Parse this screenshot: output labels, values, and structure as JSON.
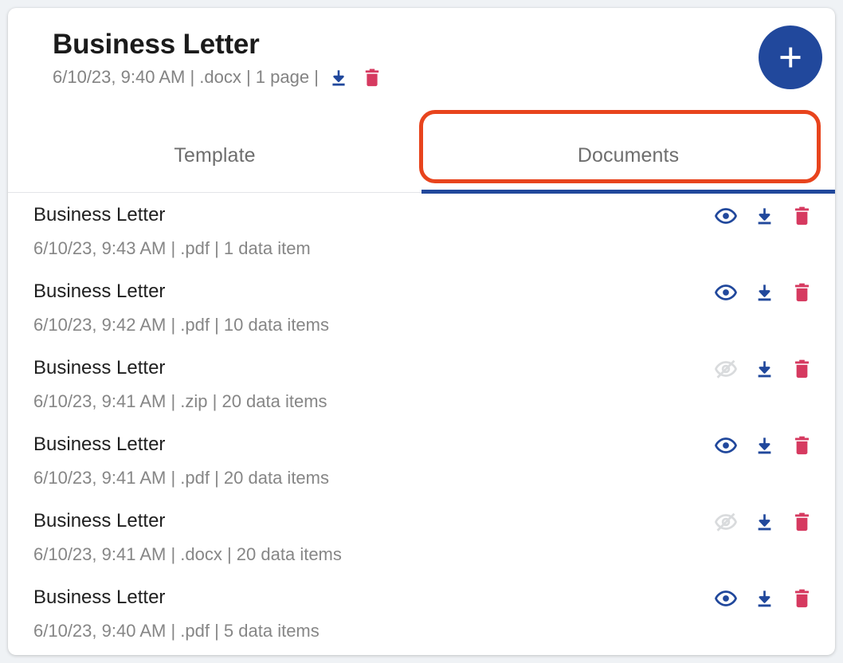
{
  "colors": {
    "page_background": "#eff2f5",
    "card_background": "#ffffff",
    "accent_blue": "#21489c",
    "danger_red": "#d63a60",
    "annotation_orange": "#e8441d",
    "muted_text": "#868686",
    "title_text": "#1f1f1f"
  },
  "header": {
    "title": "Business Letter",
    "meta": "6/10/23, 9:40 AM | .docx | 1 page |",
    "download_icon": "download-icon",
    "delete_icon": "trash-icon",
    "add_button": {
      "icon": "plus-icon",
      "label": "+"
    }
  },
  "tabs": {
    "items": [
      {
        "label": "Template",
        "active": false
      },
      {
        "label": "Documents",
        "active": true
      }
    ],
    "active_index": 1,
    "annotation": "highlight-rectangle-around-documents-tab"
  },
  "documents": [
    {
      "title": "Business Letter",
      "meta": "6/10/23, 9:43 AM | .pdf | 1 data item",
      "visibility_icon": "eye-icon",
      "visible": true,
      "download_icon": "download-icon",
      "delete_icon": "trash-icon"
    },
    {
      "title": "Business Letter",
      "meta": "6/10/23, 9:42 AM | .pdf | 10 data items",
      "visibility_icon": "eye-icon",
      "visible": true,
      "download_icon": "download-icon",
      "delete_icon": "trash-icon"
    },
    {
      "title": "Business Letter",
      "meta": "6/10/23, 9:41 AM | .zip | 20 data items",
      "visibility_icon": "eye-off-icon",
      "visible": false,
      "download_icon": "download-icon",
      "delete_icon": "trash-icon"
    },
    {
      "title": "Business Letter",
      "meta": "6/10/23, 9:41 AM | .pdf | 20 data items",
      "visibility_icon": "eye-icon",
      "visible": true,
      "download_icon": "download-icon",
      "delete_icon": "trash-icon"
    },
    {
      "title": "Business Letter",
      "meta": "6/10/23, 9:41 AM | .docx | 20 data items",
      "visibility_icon": "eye-off-icon",
      "visible": false,
      "download_icon": "download-icon",
      "delete_icon": "trash-icon"
    },
    {
      "title": "Business Letter",
      "meta": "6/10/23, 9:40 AM | .pdf | 5 data items",
      "visibility_icon": "eye-icon",
      "visible": true,
      "download_icon": "download-icon",
      "delete_icon": "trash-icon"
    }
  ]
}
